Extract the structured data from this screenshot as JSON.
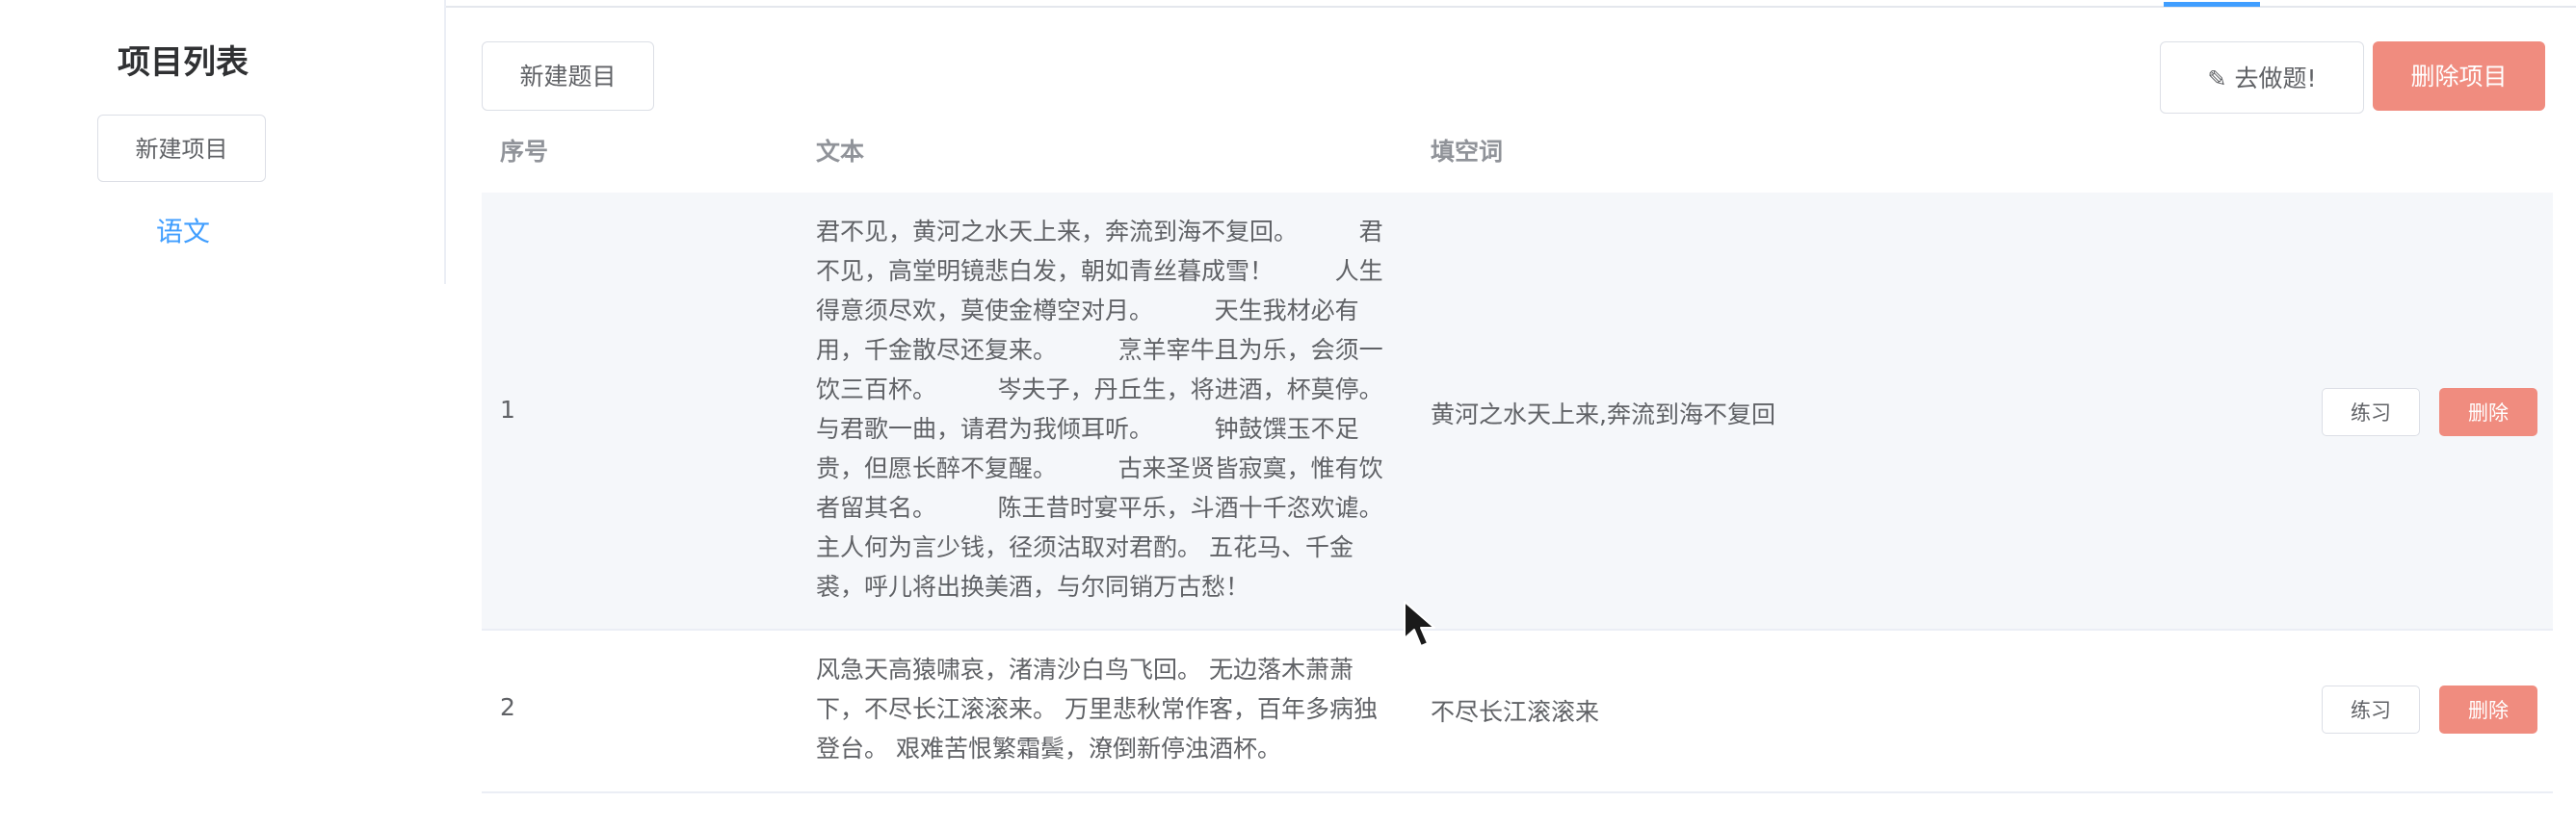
{
  "sidebar": {
    "title": "项目列表",
    "new_project_label": "新建项目",
    "projects": [
      "语文"
    ]
  },
  "toolbar": {
    "new_question_label": "新建题目",
    "do_question_label": "去做题!",
    "do_question_icon": "pencil-icon",
    "delete_project_label": "删除项目"
  },
  "table": {
    "headers": {
      "index": "序号",
      "text": "文本",
      "blank": "填空词"
    },
    "rows": [
      {
        "index": "1",
        "text": "君不见，黄河之水天上来，奔流到海不复回。        君不见，高堂明镜悲白发，朝如青丝暮成雪！        人生得意须尽欢，莫使金樽空对月。        天生我材必有用，千金散尽还复来。        烹羊宰牛且为乐，会须一饮三百杯。        岑夫子，丹丘生，将进酒，杯莫停。        与君歌一曲，请君为我倾耳听。        钟鼓馔玉不足贵，但愿长醉不复醒。        古来圣贤皆寂寞，惟有饮者留其名。        陈王昔时宴平乐，斗酒十千恣欢谑。 主人何为言少钱，径须沽取对君酌。 五花马、千金裘，呼儿将出换美酒，与尔同销万古愁！",
        "blank": "黄河之水天上来,奔流到海不复回",
        "practice_label": "练习",
        "delete_label": "删除"
      },
      {
        "index": "2",
        "text": "风急天高猿啸哀，渚清沙白鸟飞回。 无边落木萧萧下，不尽长江滚滚来。 万里悲秋常作客，百年多病独登台。 艰难苦恨繁霜鬓，潦倒新停浊酒杯。",
        "blank": "不尽长江滚滚来",
        "practice_label": "练习",
        "delete_label": "删除"
      }
    ]
  },
  "colors": {
    "accent": "#409eff",
    "danger": "#f08c7f",
    "row_highlight": "#f5f7fa"
  }
}
